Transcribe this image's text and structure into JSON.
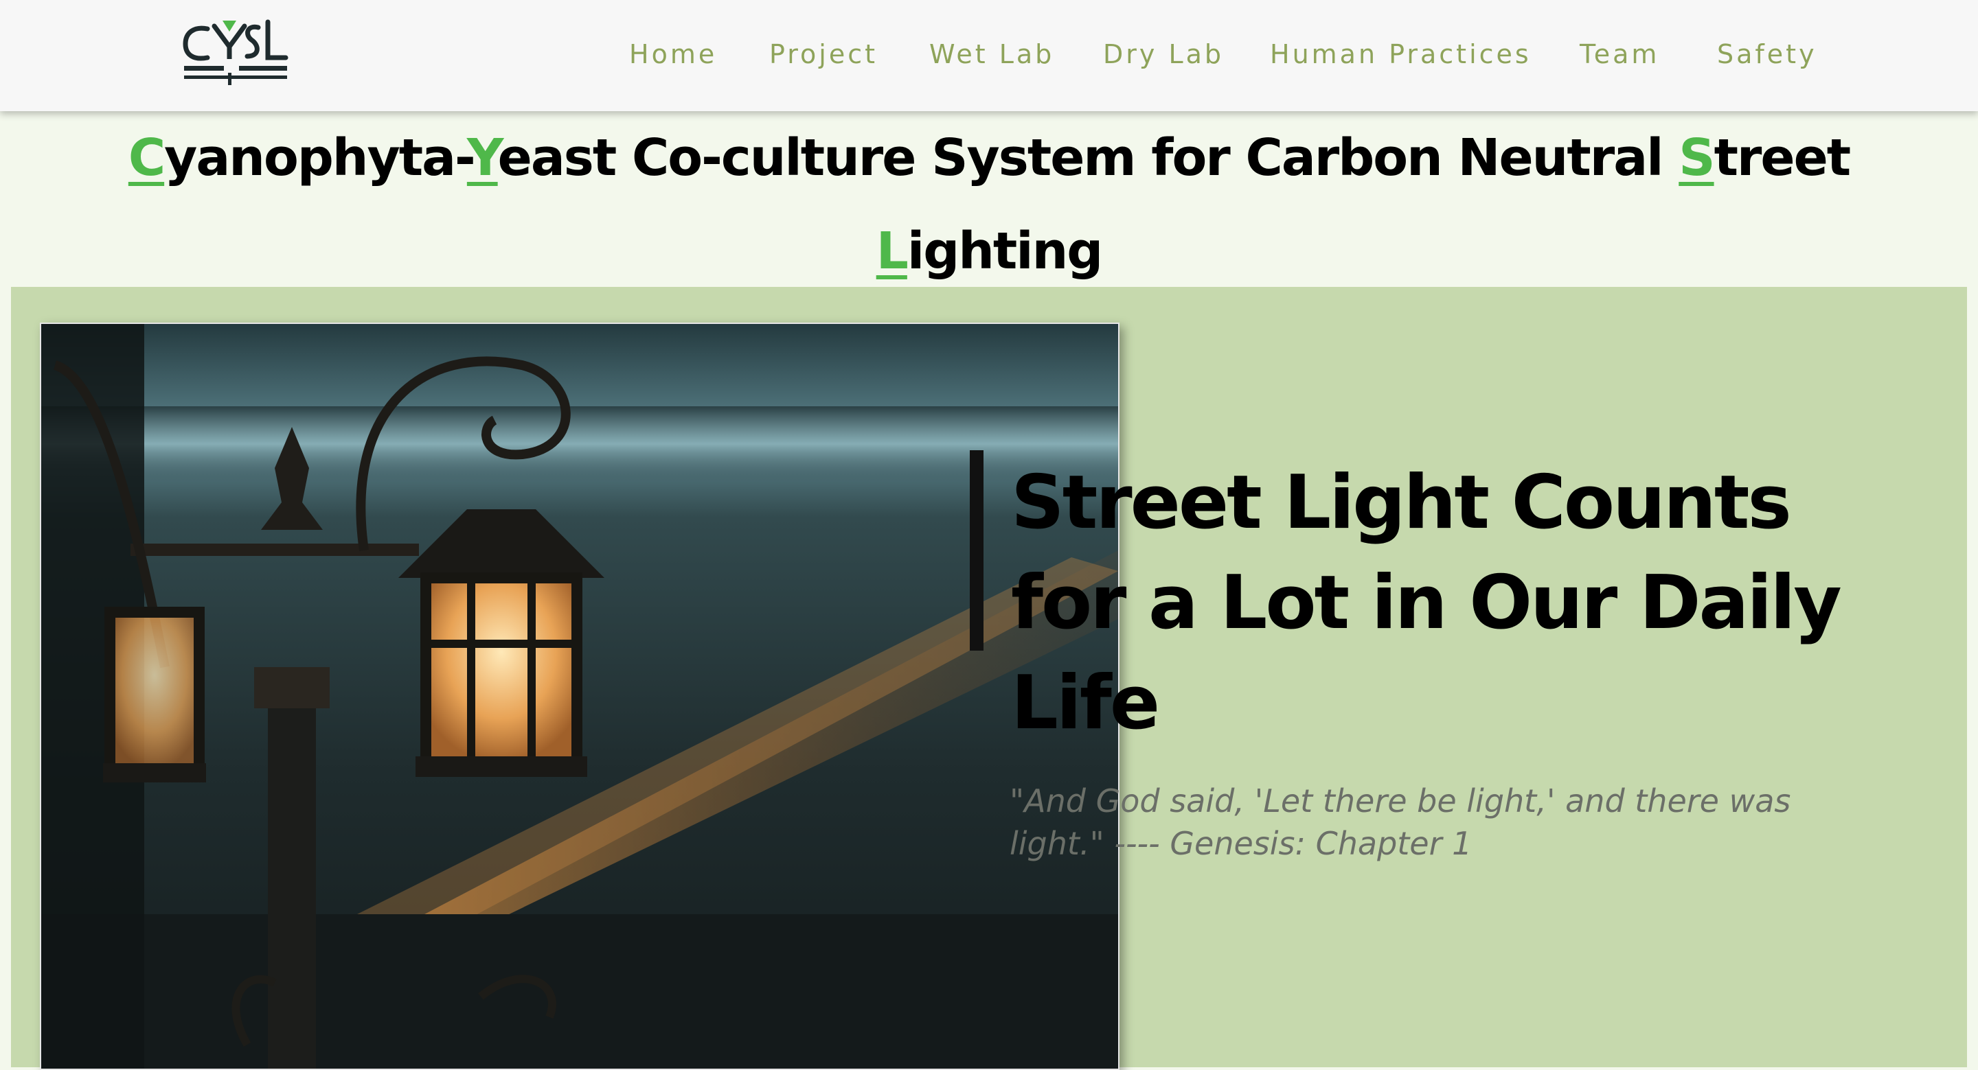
{
  "nav": {
    "logo_text": "CYSL",
    "items": [
      {
        "label": "Home"
      },
      {
        "label": "Project"
      },
      {
        "label": "Wet Lab"
      },
      {
        "label": "Dry Lab"
      },
      {
        "label": "Human Practices"
      },
      {
        "label": "Team"
      },
      {
        "label": "Safety"
      }
    ]
  },
  "hero": {
    "title_parts": [
      {
        "cap": "C",
        "rest": "yanophyta-"
      },
      {
        "cap": "Y",
        "rest": "east Co-culture System for Carbon Neutral "
      },
      {
        "cap": "S",
        "rest": "treet"
      },
      {
        "cap": "L",
        "rest": "ighting"
      }
    ]
  },
  "feature": {
    "headline": "Street Light Counts for a Lot in Our Daily Life",
    "quote": "\"And God said, 'Let there be light,' and there was light.\" ---- Genesis: Chapter 1"
  },
  "colors": {
    "accent_green": "#4fb84a",
    "nav_text": "#8ea35a",
    "band_bg": "#c6d9ad",
    "page_bg": "#f3f8ec",
    "logo_dark": "#1f2b2e"
  }
}
